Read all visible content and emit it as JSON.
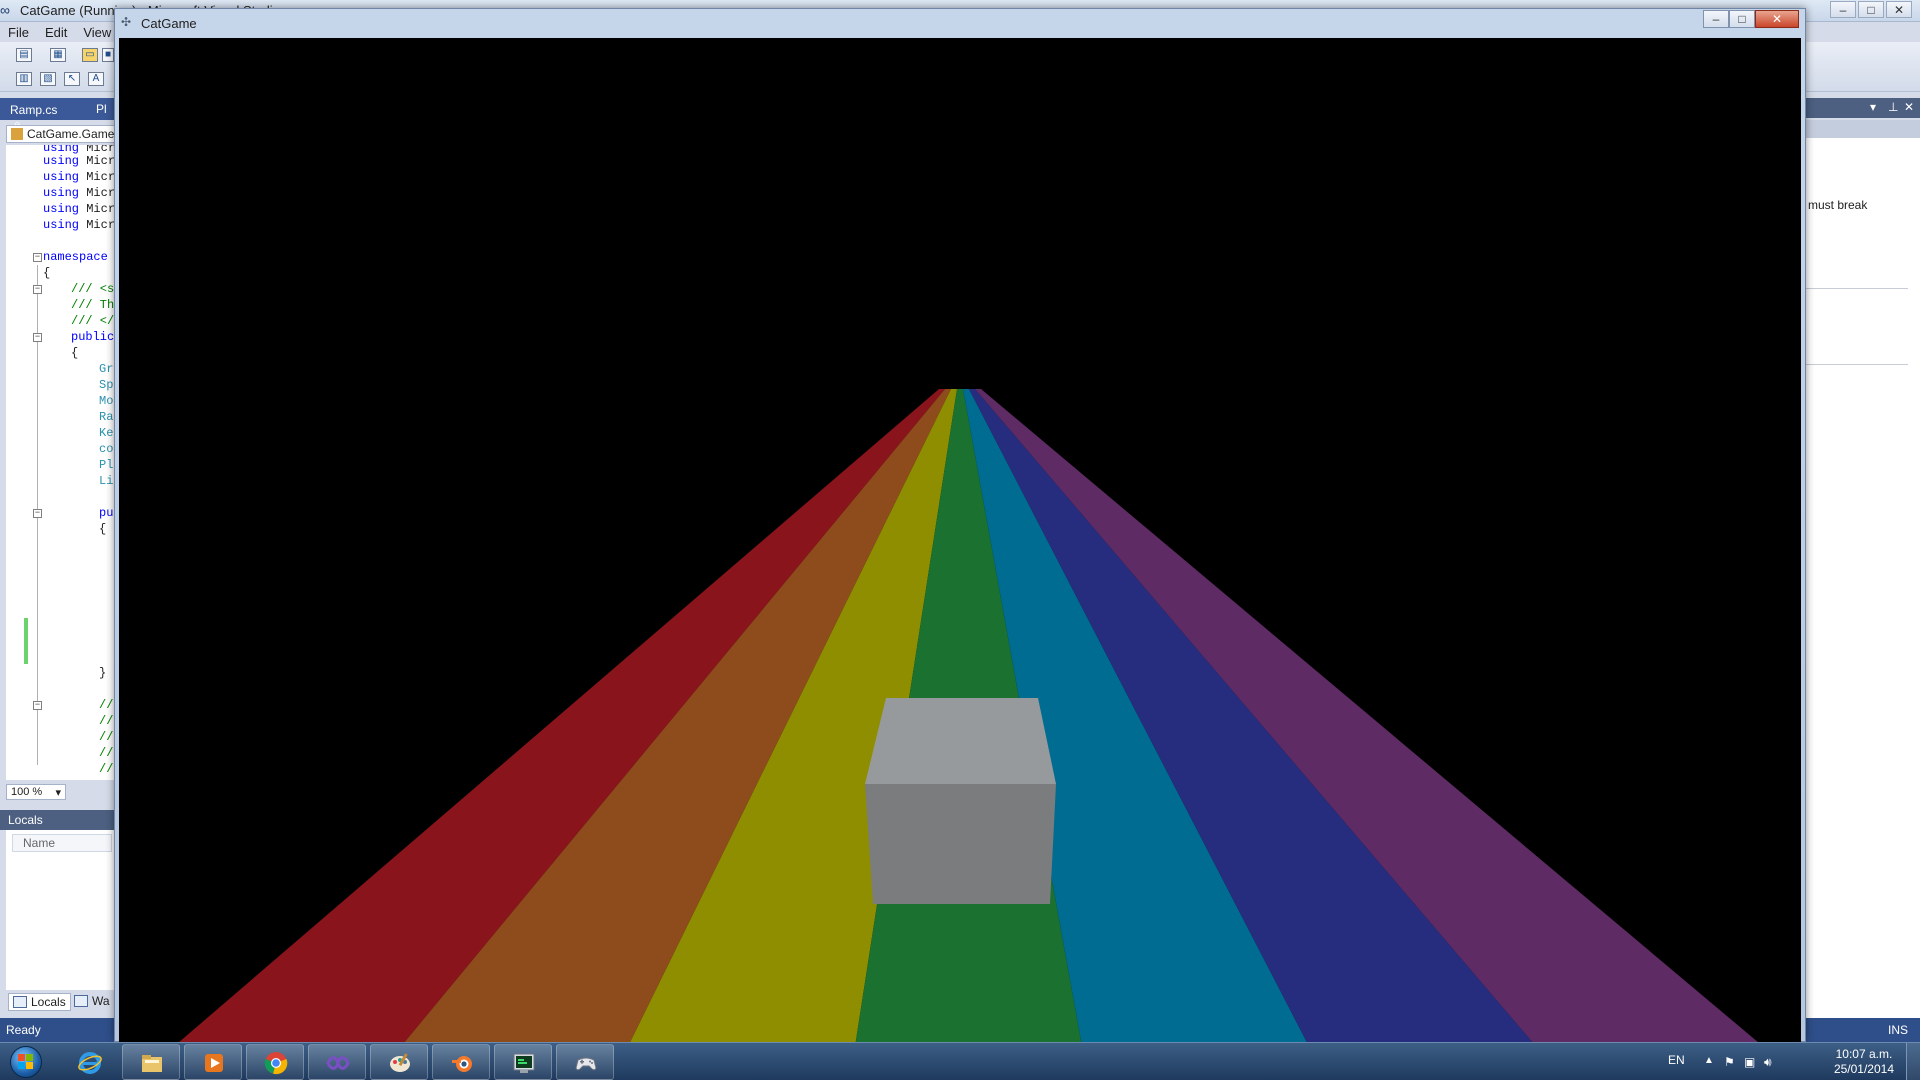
{
  "vs": {
    "title": "CatGame (Running) - Microsoft Visual Studio",
    "menu": [
      "File",
      "Edit",
      "View"
    ],
    "caption": {
      "minimize": "–",
      "maximize": "□",
      "close": "✕"
    },
    "tabs": {
      "active": "Ramp.cs",
      "second": "Pl"
    },
    "nav_combo": "CatGame.Game",
    "code": {
      "using": "using",
      "using_suffix": "Micr",
      "namespace": "namespace",
      "open_brace": "{",
      "close_brace": "}",
      "doc1": "/// <s",
      "doc2": "/// Th",
      "doc3": "/// </",
      "public": "public",
      "members": [
        "Gr",
        "Sp",
        "Mo",
        "Ra",
        "Ke",
        "co",
        "Pl",
        "Li"
      ],
      "pu": "pu",
      "comments": [
        "//",
        "//",
        "//",
        "//",
        "//"
      ]
    },
    "zoom": "100 %",
    "locals": {
      "title": "Locals",
      "column": "Name",
      "tab1": "Locals",
      "tab2": "Wa"
    },
    "right_panel": {
      "text": "must break"
    },
    "status": {
      "left": "Ready",
      "right": "INS"
    }
  },
  "game": {
    "title": "CatGame",
    "caption": {
      "minimize": "–",
      "maximize": "□",
      "close": "✕"
    },
    "scene": {
      "background": "#000000",
      "stripe_colors": [
        "#8a141b",
        "#8e4c1c",
        "#8f8e00",
        "#1a7130",
        "#006c91",
        "#262d7f",
        "#5e2b64"
      ],
      "cube": {
        "top": "#979a9d",
        "front": "#7a7c7e"
      }
    }
  },
  "taskbar": {
    "items": [
      "start-button",
      "ie-icon",
      "explorer-icon",
      "media-player-icon",
      "chrome-icon",
      "visual-studio-icon",
      "paint-icon",
      "blender-icon",
      "terminal-icon",
      "game-controller-icon"
    ],
    "lang": "EN",
    "time": "10:07 a.m.",
    "date": "25/01/2014"
  }
}
